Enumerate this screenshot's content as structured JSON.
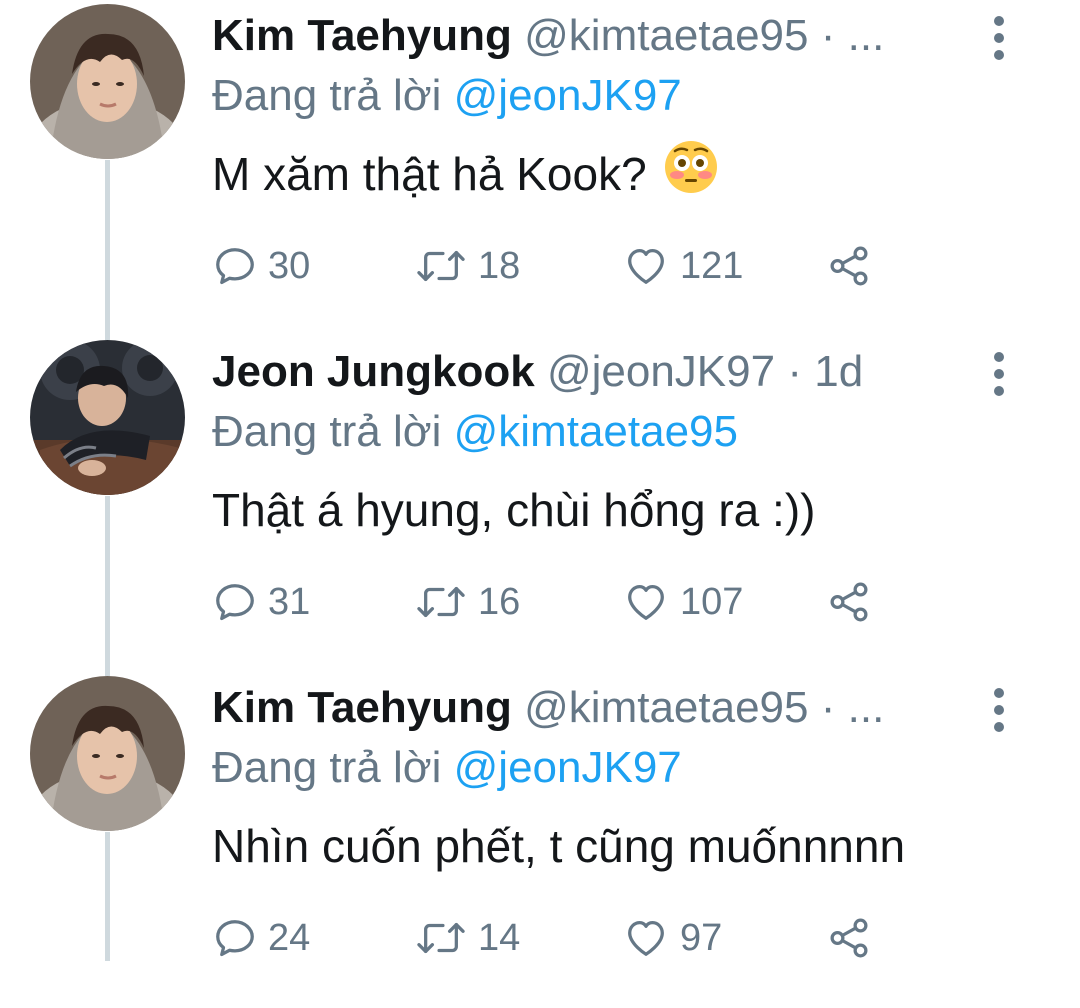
{
  "thread": {
    "tweets": [
      {
        "name": "Kim Taehyung",
        "handle": "@kimtaetae95",
        "dot": "·",
        "time": "...",
        "reply_prefix": "Đang trả lời",
        "reply_to": "@jeonJK97",
        "text": "M xăm thật hả Kook?",
        "emoji": "flushed-face-emoji",
        "replies": "30",
        "retweets": "18",
        "likes": "121"
      },
      {
        "name": "Jeon Jungkook",
        "handle": "@jeonJK97",
        "dot": "·",
        "time": "1d",
        "reply_prefix": "Đang trả lời",
        "reply_to": "@kimtaetae95",
        "text": "Thật á hyung, chùi hổng ra :))",
        "replies": "31",
        "retweets": "16",
        "likes": "107"
      },
      {
        "name": "Kim Taehyung",
        "handle": "@kimtaetae95",
        "dot": "·",
        "time": "...",
        "reply_prefix": "Đang trả lời",
        "reply_to": "@jeonJK97",
        "text": "Nhìn cuốn phết, t cũng muốnnnnn",
        "replies": "24",
        "retweets": "14",
        "likes": "97"
      }
    ]
  },
  "icons": {
    "reply": "reply-icon",
    "retweet": "retweet-icon",
    "like": "heart-icon",
    "share": "share-icon",
    "more": "more-vertical-icon"
  },
  "colors": {
    "text": "#14171a",
    "muted": "#657786",
    "link": "#1da1f2",
    "thread_line": "#cfd9de"
  }
}
